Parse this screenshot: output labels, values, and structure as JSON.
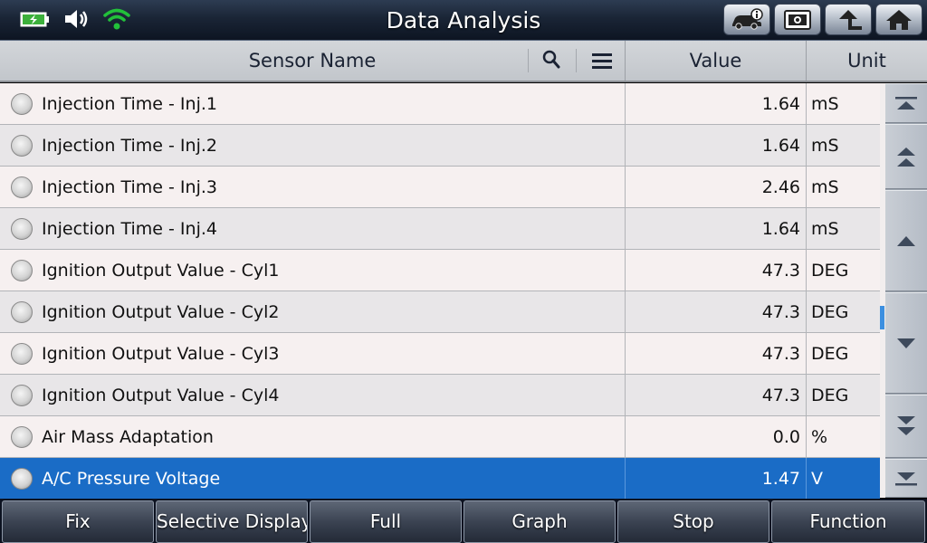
{
  "app": {
    "title": "Data Analysis"
  },
  "status": {
    "battery_icon": "battery-charging-icon",
    "volume_icon": "volume-icon",
    "wifi_icon": "wifi-icon",
    "wifi_color": "#22c03a"
  },
  "title_buttons": [
    {
      "icon": "vehicle-info-icon"
    },
    {
      "icon": "screenshot-icon"
    },
    {
      "icon": "back-icon"
    },
    {
      "icon": "home-icon"
    }
  ],
  "table": {
    "headers": {
      "name": "Sensor Name",
      "value": "Value",
      "unit": "Unit"
    },
    "rows": [
      {
        "name": "Injection Time - Inj.1",
        "value": "1.64",
        "unit": "mS"
      },
      {
        "name": "Injection Time - Inj.2",
        "value": "1.64",
        "unit": "mS"
      },
      {
        "name": "Injection Time - Inj.3",
        "value": "2.46",
        "unit": "mS"
      },
      {
        "name": "Injection Time - Inj.4",
        "value": "1.64",
        "unit": "mS"
      },
      {
        "name": "Ignition Output Value - Cyl1",
        "value": "47.3",
        "unit": "DEG"
      },
      {
        "name": "Ignition Output Value - Cyl2",
        "value": "47.3",
        "unit": "DEG"
      },
      {
        "name": "Ignition Output Value - Cyl3",
        "value": "47.3",
        "unit": "DEG"
      },
      {
        "name": "Ignition Output Value - Cyl4",
        "value": "47.3",
        "unit": "DEG"
      },
      {
        "name": "Air Mass Adaptation",
        "value": "0.0",
        "unit": "%"
      },
      {
        "name": "A/C Pressure Voltage",
        "value": "1.47",
        "unit": "V"
      }
    ],
    "selected_row": 9,
    "selection_color": "#1a6cc6"
  },
  "nav": [
    {
      "icon": "scroll-top-icon"
    },
    {
      "icon": "page-up-icon"
    },
    {
      "icon": "scroll-up-icon"
    },
    {
      "icon": "scroll-down-icon"
    },
    {
      "icon": "page-down-icon"
    },
    {
      "icon": "scroll-bottom-icon"
    }
  ],
  "bottom_buttons": [
    "Fix",
    "Selective Display",
    "Full",
    "Graph",
    "Stop",
    "Function"
  ]
}
